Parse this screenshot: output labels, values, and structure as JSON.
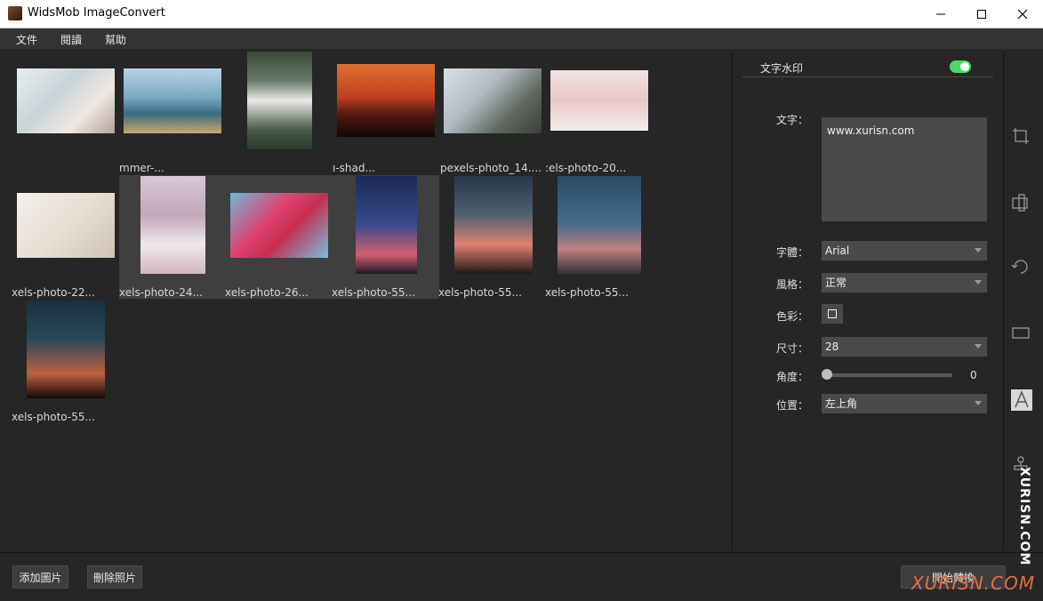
{
  "window": {
    "title": "WidsMob ImageConvert"
  },
  "menu": [
    "文件",
    "閱讀",
    "幫助"
  ],
  "thumbnails": [
    {
      "label": ""
    },
    {
      "label": "mmer-..."
    },
    {
      "label": ""
    },
    {
      "label": "ı-shad..."
    },
    {
      "label": "pexels-photo_14...."
    },
    {
      "label": ":els-photo-20..."
    },
    {
      "label": "xels-photo-22..."
    },
    {
      "label": "xels-photo-24..."
    },
    {
      "label": "xels-photo-26..."
    },
    {
      "label": "xels-photo-55..."
    },
    {
      "label": "xels-photo-55..."
    },
    {
      "label": "xels-photo-55..."
    },
    {
      "label": "xels-photo-55..."
    }
  ],
  "panel": {
    "title": "文字水印",
    "toggle_on": true,
    "text_label": "文字：",
    "text_value": "www.xurisn.com",
    "font_label": "字體：",
    "font_value": "Arial",
    "style_label": "風格：",
    "style_value": "正常",
    "color_label": "色彩：",
    "size_label": "尺寸：",
    "size_value": "28",
    "angle_label": "角度：",
    "angle_value": "0",
    "position_label": "位置：",
    "position_value": "左上角"
  },
  "toolbar_icons": [
    "crop-icon",
    "resize-icon",
    "rotate-icon",
    "border-icon",
    "text-watermark-icon",
    "stamp-icon"
  ],
  "buttons": {
    "add": "添加圖片",
    "delete": "刪除照片",
    "start": "開始轉換"
  },
  "overlay_watermarks": {
    "vertical": "XURISN.COM",
    "bottom": "XURISN.COM"
  },
  "colors": {
    "accent_toggle": "#4cd964",
    "background": "#262626"
  }
}
